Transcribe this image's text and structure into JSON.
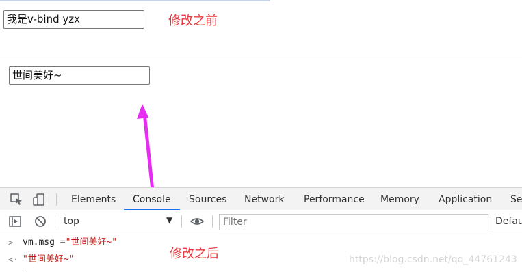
{
  "page": {
    "input_before": "我是v-bind yzx",
    "annotation_before": "修改之前",
    "input_after": "世间美好~",
    "annotation_after": "修改之后"
  },
  "devtools": {
    "tabs": [
      "Elements",
      "Console",
      "Sources",
      "Network",
      "Performance",
      "Memory",
      "Application",
      "Se"
    ],
    "active_tab": "Console",
    "context": "top",
    "filter_placeholder": "Filter",
    "levels_label": "Defau",
    "console": {
      "input_expr": "vm.msg =",
      "input_string": "\"世间美好~\"",
      "result": "\"世间美好~\""
    }
  },
  "watermark": "https://blog.csdn.net/qq_44761243",
  "colors": {
    "annotation": "#e8383d",
    "arrow": "#e62ef0",
    "active_tab": "#1a73e8",
    "console_string": "#c41a16"
  },
  "icons": [
    "inspect-icon",
    "device-toggle-icon",
    "sidebar-toggle-icon",
    "clear-console-icon",
    "eye-icon"
  ]
}
